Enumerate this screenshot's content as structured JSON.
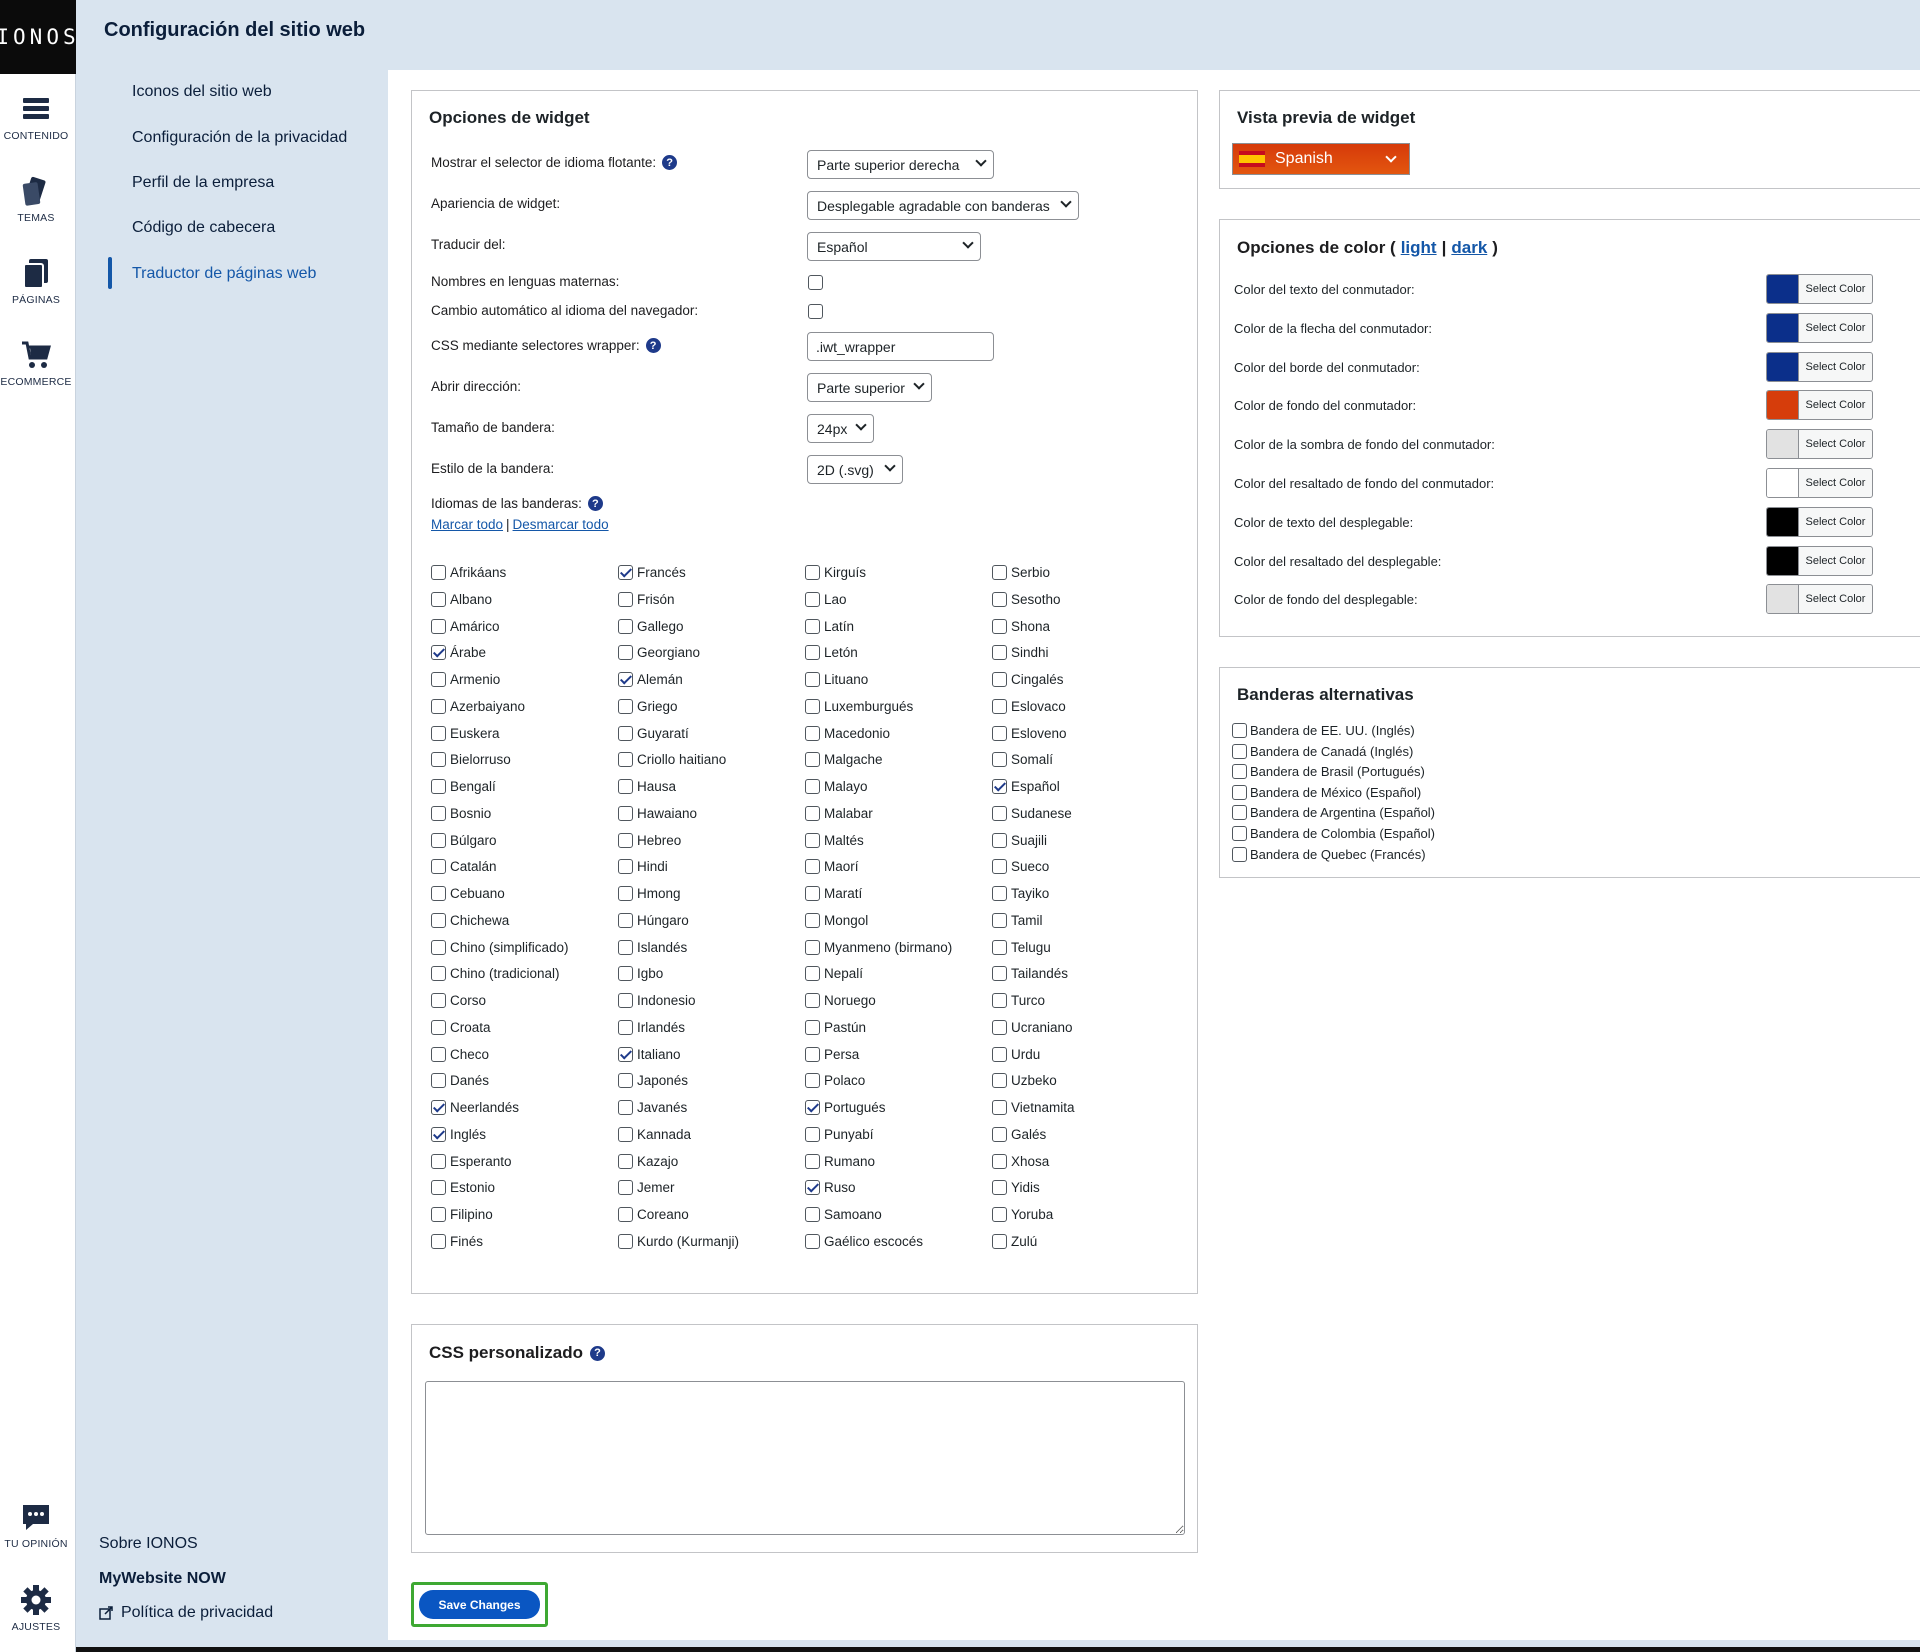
{
  "brand": "IONOS",
  "page_title": "Configuración del sitio web",
  "rail": [
    {
      "label": "CONTENIDO",
      "icon": "content-icon"
    },
    {
      "label": "TEMAS",
      "icon": "themes-icon"
    },
    {
      "label": "PÁGINAS",
      "icon": "pages-icon"
    },
    {
      "label": "ECOMMERCE",
      "icon": "cart-icon"
    },
    {
      "label": "TU OPINIÓN",
      "icon": "feedback-icon"
    },
    {
      "label": "AJUSTES",
      "icon": "gear-icon"
    }
  ],
  "subnav": {
    "items": [
      "Iconos del sitio web",
      "Configuración de la privacidad",
      "Perfil de la empresa",
      "Código de cabecera",
      "Traductor de páginas web"
    ],
    "active": "Traductor de páginas web",
    "footer": {
      "about": "Sobre IONOS",
      "product": "MyWebsite NOW",
      "privacy": "Política de privacidad"
    }
  },
  "widget_options": {
    "title": "Opciones de widget",
    "fields": {
      "floating": {
        "label": "Mostrar el selector de idioma flotante:",
        "value": "Parte superior derecha"
      },
      "appearance": {
        "label": "Apariencia de widget:",
        "value": "Desplegable agradable con banderas"
      },
      "translate_from": {
        "label": "Traducir del:",
        "value": "Español"
      },
      "native_names": {
        "label": "Nombres en lenguas maternas:",
        "checked": false
      },
      "auto_switch": {
        "label": "Cambio automático al idioma del navegador:",
        "checked": false
      },
      "wrapper": {
        "label": "CSS mediante selectores wrapper:",
        "value": ".iwt_wrapper"
      },
      "open_direction": {
        "label": "Abrir dirección:",
        "value": "Parte superior"
      },
      "flag_size": {
        "label": "Tamaño de bandera:",
        "value": "24px"
      },
      "flag_style": {
        "label": "Estilo de la bandera:",
        "value": "2D (.svg)"
      }
    },
    "flag_languages_label": "Idiomas de las banderas:",
    "check_all": "Marcar todo",
    "separator": "|",
    "uncheck_all": "Desmarcar todo",
    "languages": [
      [
        [
          "Afrikáans",
          0
        ],
        [
          "Albano",
          0
        ],
        [
          "Amárico",
          0
        ],
        [
          "Árabe",
          1
        ],
        [
          "Armenio",
          0
        ],
        [
          "Azerbaiyano",
          0
        ],
        [
          "Euskera",
          0
        ],
        [
          "Bielorruso",
          0
        ],
        [
          "Bengalí",
          0
        ],
        [
          "Bosnio",
          0
        ],
        [
          "Búlgaro",
          0
        ],
        [
          "Catalán",
          0
        ],
        [
          "Cebuano",
          0
        ],
        [
          "Chichewa",
          0
        ],
        [
          "Chino (simplificado)",
          0
        ],
        [
          "Chino (tradicional)",
          0
        ],
        [
          "Corso",
          0
        ],
        [
          "Croata",
          0
        ],
        [
          "Checo",
          0
        ],
        [
          "Danés",
          0
        ],
        [
          "Neerlandés",
          1
        ],
        [
          "Inglés",
          1
        ],
        [
          "Esperanto",
          0
        ],
        [
          "Estonio",
          0
        ],
        [
          "Filipino",
          0
        ],
        [
          "Finés",
          0
        ]
      ],
      [
        [
          "Francés",
          1
        ],
        [
          "Frisón",
          0
        ],
        [
          "Gallego",
          0
        ],
        [
          "Georgiano",
          0
        ],
        [
          "Alemán",
          1
        ],
        [
          "Griego",
          0
        ],
        [
          "Guyaratí",
          0
        ],
        [
          "Criollo haitiano",
          0
        ],
        [
          "Hausa",
          0
        ],
        [
          "Hawaiano",
          0
        ],
        [
          "Hebreo",
          0
        ],
        [
          "Hindi",
          0
        ],
        [
          "Hmong",
          0
        ],
        [
          "Húngaro",
          0
        ],
        [
          "Islandés",
          0
        ],
        [
          "Igbo",
          0
        ],
        [
          "Indonesio",
          0
        ],
        [
          "Irlandés",
          0
        ],
        [
          "Italiano",
          1
        ],
        [
          "Japonés",
          0
        ],
        [
          "Javanés",
          0
        ],
        [
          "Kannada",
          0
        ],
        [
          "Kazajo",
          0
        ],
        [
          "Jemer",
          0
        ],
        [
          "Coreano",
          0
        ],
        [
          "Kurdo (Kurmanji)",
          0
        ]
      ],
      [
        [
          "Kirguís",
          0
        ],
        [
          "Lao",
          0
        ],
        [
          "Latín",
          0
        ],
        [
          "Letón",
          0
        ],
        [
          "Lituano",
          0
        ],
        [
          "Luxemburgués",
          0
        ],
        [
          "Macedonio",
          0
        ],
        [
          "Malgache",
          0
        ],
        [
          "Malayo",
          0
        ],
        [
          "Malabar",
          0
        ],
        [
          "Maltés",
          0
        ],
        [
          "Maorí",
          0
        ],
        [
          "Maratí",
          0
        ],
        [
          "Mongol",
          0
        ],
        [
          "Myanmeno (birmano)",
          0
        ],
        [
          "Nepalí",
          0
        ],
        [
          "Noruego",
          0
        ],
        [
          "Pastún",
          0
        ],
        [
          "Persa",
          0
        ],
        [
          "Polaco",
          0
        ],
        [
          "Portugués",
          1
        ],
        [
          "Punyabí",
          0
        ],
        [
          "Rumano",
          0
        ],
        [
          "Ruso",
          1
        ],
        [
          "Samoano",
          0
        ],
        [
          "Gaélico escocés",
          0
        ]
      ],
      [
        [
          "Serbio",
          0
        ],
        [
          "Sesotho",
          0
        ],
        [
          "Shona",
          0
        ],
        [
          "Sindhi",
          0
        ],
        [
          "Cingalés",
          0
        ],
        [
          "Eslovaco",
          0
        ],
        [
          "Esloveno",
          0
        ],
        [
          "Somalí",
          0
        ],
        [
          "Español",
          1
        ],
        [
          "Sudanese",
          0
        ],
        [
          "Suajili",
          0
        ],
        [
          "Sueco",
          0
        ],
        [
          "Tayiko",
          0
        ],
        [
          "Tamil",
          0
        ],
        [
          "Telugu",
          0
        ],
        [
          "Tailandés",
          0
        ],
        [
          "Turco",
          0
        ],
        [
          "Ucraniano",
          0
        ],
        [
          "Urdu",
          0
        ],
        [
          "Uzbeko",
          0
        ],
        [
          "Vietnamita",
          0
        ],
        [
          "Galés",
          0
        ],
        [
          "Xhosa",
          0
        ],
        [
          "Yidis",
          0
        ],
        [
          "Yoruba",
          0
        ],
        [
          "Zulú",
          0
        ]
      ]
    ]
  },
  "custom_css": {
    "title": "CSS personalizado",
    "value": ""
  },
  "save_label": "Save Changes",
  "preview": {
    "title": "Vista previa de widget",
    "selected": "Spanish"
  },
  "color_options": {
    "title_prefix": "Opciones de color (",
    "light": "light",
    "sep": "|",
    "dark": "dark",
    "title_suffix": ")",
    "button_label": "Select Color",
    "rows": [
      {
        "label": "Color del texto del conmutador:",
        "color": "#0b2f8a"
      },
      {
        "label": "Color de la flecha del conmutador:",
        "color": "#0b2f8a"
      },
      {
        "label": "Color del borde del conmutador:",
        "color": "#0b2f8a"
      },
      {
        "label": "Color de fondo del conmutador:",
        "color": "#d63d0b"
      },
      {
        "label": "Color de la sombra de fondo del conmutador:",
        "color": "#e2e2e2"
      },
      {
        "label": "Color del resaltado de fondo del conmutador:",
        "color": "#ffffff"
      },
      {
        "label": "Color de texto del desplegable:",
        "color": "#000000"
      },
      {
        "label": "Color del resaltado del desplegable:",
        "color": "#000000"
      },
      {
        "label": "Color de fondo del desplegable:",
        "color": "#e2e2e2"
      }
    ]
  },
  "alt_flags": {
    "title": "Banderas alternativas",
    "items": [
      "Bandera de EE. UU. (Inglés)",
      "Bandera de Canadá (Inglés)",
      "Bandera de Brasil (Portugués)",
      "Bandera de México (Español)",
      "Bandera de Argentina (Español)",
      "Bandera de Colombia (Español)",
      "Bandera de Quebec (Francés)"
    ]
  }
}
